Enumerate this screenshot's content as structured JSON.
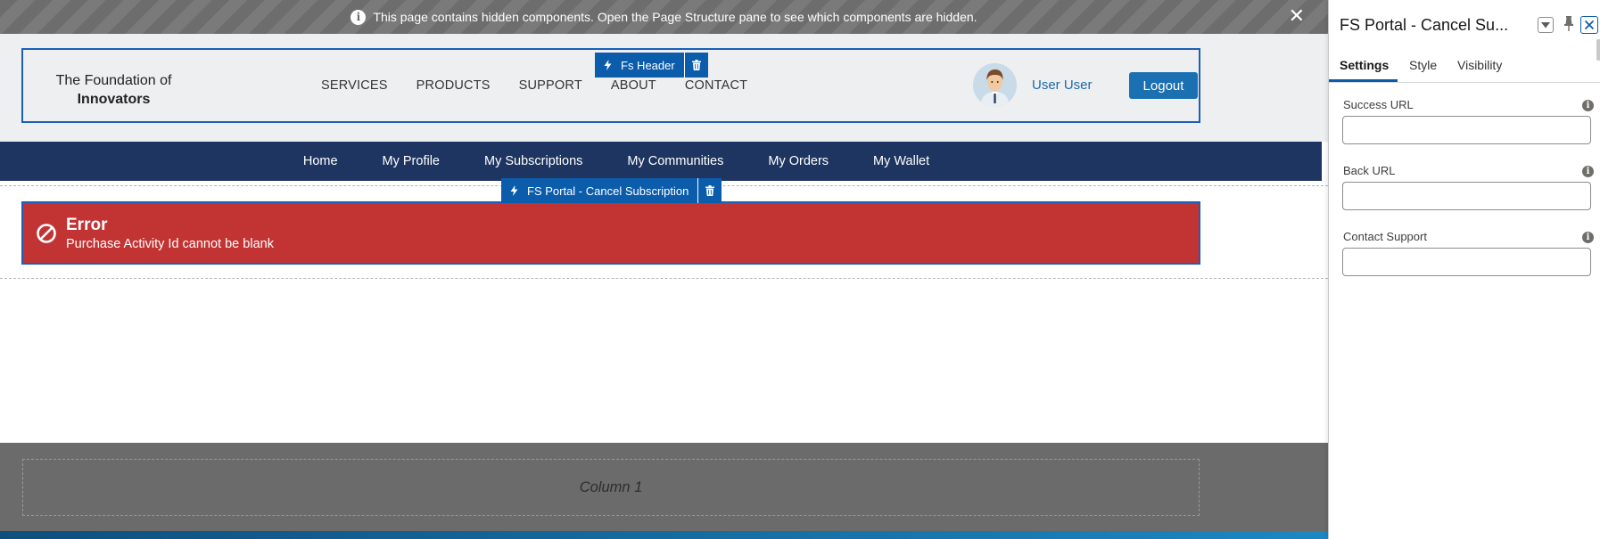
{
  "notice": {
    "text": "This page contains hidden components. Open the Page Structure pane to see which components are hidden.",
    "close": "✕"
  },
  "header": {
    "logo_line1": "The Foundation of",
    "logo_line2": "Innovators",
    "nav": [
      "SERVICES",
      "PRODUCTS",
      "SUPPORT",
      "ABOUT",
      "CONTACT"
    ],
    "user_name": "User User",
    "logout_label": "Logout"
  },
  "header_tag": {
    "label": "Fs Header"
  },
  "sub_nav": [
    "Home",
    "My Profile",
    "My Subscriptions",
    "My Communities",
    "My Orders",
    "My Wallet"
  ],
  "component_tag": {
    "label": "FS Portal - Cancel Subscription"
  },
  "error": {
    "title": "Error",
    "message": "Purchase Activity Id cannot be blank"
  },
  "footer": {
    "column_label": "Column 1"
  },
  "panel": {
    "title": "FS Portal - Cancel Su...",
    "tabs": [
      "Settings",
      "Style",
      "Visibility"
    ],
    "active_tab": "Settings",
    "fields": [
      {
        "label": "Success URL",
        "value": ""
      },
      {
        "label": "Back URL",
        "value": ""
      },
      {
        "label": "Contact Support",
        "value": ""
      }
    ]
  },
  "colors": {
    "accent": "#0b5cab",
    "nav_bar": "#1d3560",
    "error": "#c23434",
    "logout": "#1a70b0"
  },
  "icons": [
    "info-icon",
    "close-icon",
    "lightning-icon",
    "trash-icon",
    "error-ban-icon",
    "avatar",
    "dropdown-icon",
    "pin-icon"
  ]
}
